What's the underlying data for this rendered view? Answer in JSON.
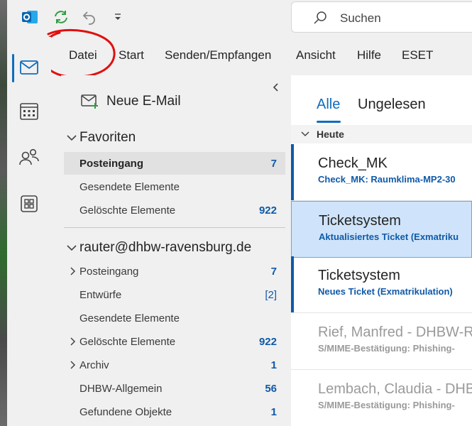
{
  "titlebar": {
    "search_placeholder": "Suchen"
  },
  "menu": [
    {
      "label": "Datei"
    },
    {
      "label": "Start"
    },
    {
      "label": "Senden/Empfangen"
    },
    {
      "label": "Ansicht"
    },
    {
      "label": "Hilfe"
    },
    {
      "label": "ESET"
    }
  ],
  "rail": {
    "items": [
      "mail-icon",
      "calendar-icon",
      "people-icon",
      "apps-icon"
    ],
    "active": "mail-icon"
  },
  "folderpane": {
    "new_mail": "Neue E-Mail",
    "favorites_title": "Favoriten",
    "favorites": [
      {
        "name": "Posteingang",
        "count": "7"
      },
      {
        "name": "Gesendete Elemente",
        "count": ""
      },
      {
        "name": "Gelöschte Elemente",
        "count": "922"
      }
    ],
    "account_title": "rauter@dhbw-ravensburg.de",
    "account_folders": [
      {
        "name": "Posteingang",
        "count": "7"
      },
      {
        "name": "Entwürfe",
        "count": "[2]"
      },
      {
        "name": "Gesendete Elemente",
        "count": ""
      },
      {
        "name": "Gelöschte Elemente",
        "count": "922"
      },
      {
        "name": "Archiv",
        "count": "1"
      },
      {
        "name": "DHBW-Allgemein",
        "count": "56"
      },
      {
        "name": "Gefundene Objekte",
        "count": "1"
      }
    ]
  },
  "messagelist": {
    "tabs": [
      "Alle",
      "Ungelesen"
    ],
    "group": "Heute",
    "messages": [
      {
        "sender": "Check_MK",
        "subject": "Check_MK: Raumklima-MP2-30"
      },
      {
        "sender": "Ticketsystem",
        "subject": "Aktualisiertes Ticket (Exmatriku"
      },
      {
        "sender": "Ticketsystem",
        "subject": "Neues Ticket (Exmatrikulation)"
      },
      {
        "sender": "Rief, Manfred - DHBW-R",
        "subject": "S/MIME-Bestätigung: Phishing-"
      },
      {
        "sender": "Lembach, Claudia - DHBV",
        "subject": "S/MIME-Bestätigung: Phishing-"
      }
    ]
  },
  "colors": {
    "accent": "#0f6cbd",
    "unread_blue": "#0f5aa8",
    "annotation_red": "#e01010"
  }
}
